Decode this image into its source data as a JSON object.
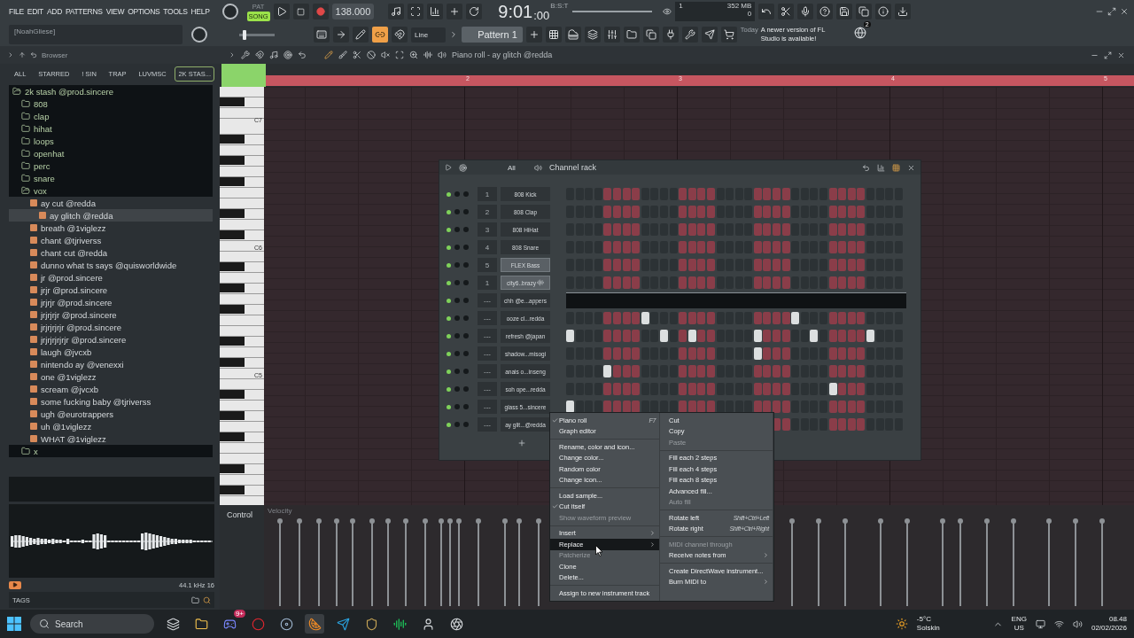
{
  "menu_bar": [
    "FILE",
    "EDIT",
    "ADD",
    "PATTERNS",
    "VIEW",
    "OPTIONS",
    "TOOLS",
    "HELP"
  ],
  "hint_panel": "[NoahGliese]",
  "master_pitch": {
    "level": 0.1
  },
  "transport": {
    "modes": [
      {
        "label": "PAT",
        "selected": false
      },
      {
        "label": "SONG",
        "selected": true
      }
    ],
    "tempo": "138.000"
  },
  "clock": {
    "time": "9:01",
    "ticks": ":00",
    "format": "B:S:T"
  },
  "monitor": {
    "voices": "1",
    "memory": "352 MB",
    "polyphony": "0"
  },
  "snap": "Line",
  "pattern": "Pattern 1",
  "news": {
    "date": "Today",
    "message": "A newer version of FL Studio is available!",
    "badge": "2"
  },
  "browser": {
    "title": "Browser",
    "tabs": [
      {
        "label": "ALL",
        "selected": false
      },
      {
        "label": "STARRED",
        "selected": false
      },
      {
        "label": "! SIN",
        "selected": false
      },
      {
        "label": "TRAP",
        "selected": false
      },
      {
        "label": "LUVMSC",
        "selected": false
      },
      {
        "label": "2K STAS...",
        "selected": true
      }
    ],
    "tree": [
      {
        "label": "2k stash @prod.sincere",
        "kind": "folder",
        "expanded": true,
        "selected": false,
        "children": [
          {
            "label": "808",
            "kind": "folder",
            "expanded": false,
            "selected": false
          },
          {
            "label": "clap",
            "kind": "folder",
            "expanded": false,
            "selected": false
          },
          {
            "label": "hihat",
            "kind": "folder",
            "expanded": false,
            "selected": false
          },
          {
            "label": "loops",
            "kind": "folder",
            "expanded": false,
            "selected": false
          },
          {
            "label": "openhat",
            "kind": "folder",
            "expanded": false,
            "selected": false
          },
          {
            "label": "perc",
            "kind": "folder",
            "expanded": false,
            "selected": false
          },
          {
            "label": "snare",
            "kind": "folder",
            "expanded": false,
            "selected": false
          },
          {
            "label": "vox",
            "kind": "folder",
            "expanded": true,
            "selected": false,
            "children": [
              {
                "label": "ay cut @redda",
                "kind": "file",
                "selected": false,
                "children": [
                  {
                    "label": "ay glitch @redda",
                    "kind": "file",
                    "selected": true
                  }
                ]
              },
              {
                "label": "breath @1viglezz",
                "kind": "file",
                "selected": false
              },
              {
                "label": "chant @tjriverss",
                "kind": "file",
                "selected": false
              },
              {
                "label": "chant cut @redda",
                "kind": "file",
                "selected": false
              },
              {
                "label": "dunno what ts says @quisworldwide",
                "kind": "file",
                "selected": false
              },
              {
                "label": "jr @prod.sincere",
                "kind": "file",
                "selected": false
              },
              {
                "label": "jrjr @prod.sincere",
                "kind": "file",
                "selected": false
              },
              {
                "label": "jrjrjr @prod.sincere",
                "kind": "file",
                "selected": false
              },
              {
                "label": "jrjrjrjr @prod.sincere",
                "kind": "file",
                "selected": false
              },
              {
                "label": "jrjrjrjrjr @prod.sincere",
                "kind": "file",
                "selected": false
              },
              {
                "label": "jrjrjrjrjrjr @prod.sincere",
                "kind": "file",
                "selected": false
              },
              {
                "label": "laugh @jvcxb",
                "kind": "file",
                "selected": false
              },
              {
                "label": "nintendo ay @venexxi",
                "kind": "file",
                "selected": false
              },
              {
                "label": "one @1viglezz",
                "kind": "file",
                "selected": false
              },
              {
                "label": "scream @jvcxb",
                "kind": "file",
                "selected": false
              },
              {
                "label": "some fucking baby @tjriverss",
                "kind": "file",
                "selected": false
              },
              {
                "label": "ugh @eurotrappers",
                "kind": "file",
                "selected": false
              },
              {
                "label": "uh @1viglezz",
                "kind": "file",
                "selected": false
              },
              {
                "label": "WHAT @1viglezz",
                "kind": "file",
                "selected": false
              }
            ]
          },
          {
            "label": "x",
            "kind": "folder",
            "expanded": false,
            "selected": false
          }
        ]
      }
    ],
    "sample_info": "44.1 kHz 16",
    "tags_label": "TAGS"
  },
  "piano_roll": {
    "title": "Piano roll - ay glitch @redda",
    "bars": [
      "2",
      "3",
      "4",
      "5"
    ],
    "octaves": [
      "C7",
      "C6",
      "C5"
    ],
    "control_label": "Control",
    "lane": "Velocity"
  },
  "channel_rack": {
    "filter": "All",
    "title": "Channel rack",
    "channels": [
      {
        "number": "1",
        "name": "808 Kick",
        "kind": "steps",
        "selected": false,
        "steps": [
          false,
          false,
          false,
          false,
          false,
          false,
          false,
          false,
          false,
          false,
          false,
          false,
          false,
          false,
          false,
          false,
          false,
          false,
          false,
          false,
          false,
          false,
          false,
          false,
          false,
          false,
          false,
          false,
          false,
          false,
          false,
          false,
          false,
          false,
          false,
          false
        ]
      },
      {
        "number": "2",
        "name": "808 Clap",
        "kind": "steps",
        "selected": false,
        "steps": [
          false,
          false,
          false,
          false,
          false,
          false,
          false,
          false,
          false,
          false,
          false,
          false,
          false,
          false,
          false,
          false,
          false,
          false,
          false,
          false,
          false,
          false,
          false,
          false,
          false,
          false,
          false,
          false,
          false,
          false,
          false,
          false,
          false,
          false,
          false,
          false
        ]
      },
      {
        "number": "3",
        "name": "808 HiHat",
        "kind": "steps",
        "selected": false,
        "steps": [
          false,
          false,
          false,
          false,
          false,
          false,
          false,
          false,
          false,
          false,
          false,
          false,
          false,
          false,
          false,
          false,
          false,
          false,
          false,
          false,
          false,
          false,
          false,
          false,
          false,
          false,
          false,
          false,
          false,
          false,
          false,
          false,
          false,
          false,
          false,
          false
        ]
      },
      {
        "number": "4",
        "name": "808 Snare",
        "kind": "steps",
        "selected": false,
        "steps": [
          false,
          false,
          false,
          false,
          false,
          false,
          false,
          false,
          false,
          false,
          false,
          false,
          false,
          false,
          false,
          false,
          false,
          false,
          false,
          false,
          false,
          false,
          false,
          false,
          false,
          false,
          false,
          false,
          false,
          false,
          false,
          false,
          false,
          false,
          false,
          false
        ]
      },
      {
        "number": "5",
        "name": "FLEX Bass",
        "kind": "steps",
        "selected": true,
        "steps": [
          false,
          false,
          false,
          false,
          false,
          false,
          false,
          false,
          false,
          false,
          false,
          false,
          false,
          false,
          false,
          false,
          false,
          false,
          false,
          false,
          false,
          false,
          false,
          false,
          false,
          false,
          false,
          false,
          false,
          false,
          false,
          false,
          false,
          false,
          false,
          false
        ]
      },
      {
        "number": "1",
        "name": "city6..brazy",
        "kind": "audio",
        "selected": true,
        "steps": [
          false,
          false,
          false,
          false,
          false,
          false,
          false,
          false,
          false,
          false,
          false,
          false,
          false,
          false,
          false,
          false,
          false,
          false,
          false,
          false,
          false,
          false,
          false,
          false,
          false,
          false,
          false,
          false,
          false,
          false,
          false,
          false,
          false,
          false,
          false,
          false
        ]
      },
      {
        "number": "---",
        "name": "chh @e...appers",
        "kind": "pianoroll",
        "selected": false
      },
      {
        "number": "---",
        "name": "ooze cl...redda",
        "kind": "steps",
        "selected": false,
        "steps": [
          false,
          false,
          false,
          false,
          false,
          false,
          false,
          false,
          true,
          false,
          false,
          false,
          false,
          false,
          false,
          false,
          false,
          false,
          false,
          false,
          false,
          false,
          false,
          false,
          true,
          false,
          false,
          false,
          false,
          false,
          false,
          false,
          false,
          false,
          false,
          false
        ]
      },
      {
        "number": "---",
        "name": "refresh @japan",
        "kind": "steps",
        "selected": false,
        "steps": [
          true,
          false,
          false,
          false,
          false,
          false,
          false,
          false,
          false,
          false,
          true,
          false,
          false,
          true,
          false,
          false,
          false,
          false,
          false,
          false,
          true,
          false,
          false,
          false,
          false,
          false,
          true,
          false,
          false,
          false,
          false,
          false,
          true,
          false,
          false,
          false
        ]
      },
      {
        "number": "---",
        "name": "shadow...misogi",
        "kind": "steps",
        "selected": false,
        "steps": [
          false,
          false,
          false,
          false,
          false,
          false,
          false,
          false,
          false,
          false,
          false,
          false,
          false,
          false,
          false,
          false,
          false,
          false,
          false,
          false,
          true,
          false,
          false,
          false,
          false,
          false,
          false,
          false,
          false,
          false,
          false,
          false,
          false,
          false,
          false,
          false
        ]
      },
      {
        "number": "---",
        "name": "anais o...inseng",
        "kind": "steps",
        "selected": false,
        "steps": [
          false,
          false,
          false,
          false,
          true,
          false,
          false,
          false,
          false,
          false,
          false,
          false,
          false,
          false,
          false,
          false,
          false,
          false,
          false,
          false,
          false,
          false,
          false,
          false,
          false,
          false,
          false,
          false,
          false,
          false,
          false,
          false,
          false,
          false,
          false,
          false
        ]
      },
      {
        "number": "---",
        "name": "soh ope...redda",
        "kind": "steps",
        "selected": false,
        "steps": [
          false,
          false,
          false,
          false,
          false,
          false,
          false,
          false,
          false,
          false,
          false,
          false,
          false,
          false,
          false,
          false,
          false,
          false,
          false,
          false,
          false,
          false,
          false,
          false,
          false,
          false,
          false,
          false,
          true,
          false,
          false,
          false,
          false,
          false,
          false,
          false
        ]
      },
      {
        "number": "---",
        "name": "glass 5...sincere",
        "kind": "steps",
        "selected": false,
        "steps": [
          true,
          false,
          false,
          false,
          false,
          false,
          false,
          false,
          false,
          false,
          false,
          false,
          false,
          false,
          false,
          false,
          false,
          false,
          false,
          false,
          false,
          false,
          false,
          false,
          false,
          false,
          false,
          false,
          false,
          false,
          false,
          false,
          false,
          false,
          false,
          false
        ]
      },
      {
        "number": "---",
        "name": "ay glit...@redda",
        "kind": "steps",
        "selected": false,
        "steps": [
          false,
          false,
          false,
          false,
          false,
          false,
          false,
          false,
          false,
          false,
          false,
          false,
          false
        ]
      }
    ]
  },
  "context_menu": {
    "columns": [
      [
        {
          "kind": "item",
          "label": "Piano roll",
          "shortcut": "F7",
          "checked": true,
          "disabled": false,
          "highlighted": false,
          "submenu": false
        },
        {
          "kind": "item",
          "label": "Graph editor",
          "checked": false,
          "disabled": false,
          "highlighted": false,
          "submenu": false
        },
        {
          "kind": "separator"
        },
        {
          "kind": "item",
          "label": "Rename, color and icon...",
          "checked": false,
          "disabled": false,
          "highlighted": false,
          "submenu": false
        },
        {
          "kind": "item",
          "label": "Change color...",
          "checked": false,
          "disabled": false,
          "highlighted": false,
          "submenu": false
        },
        {
          "kind": "item",
          "label": "Random color",
          "checked": false,
          "disabled": false,
          "highlighted": false,
          "submenu": false
        },
        {
          "kind": "item",
          "label": "Change icon...",
          "checked": false,
          "disabled": false,
          "highlighted": false,
          "submenu": false
        },
        {
          "kind": "separator"
        },
        {
          "kind": "item",
          "label": "Load sample...",
          "checked": false,
          "disabled": false,
          "highlighted": false,
          "submenu": false
        },
        {
          "kind": "item",
          "label": "Cut itself",
          "checked": true,
          "disabled": false,
          "highlighted": false,
          "submenu": false
        },
        {
          "kind": "item",
          "label": "Show waveform preview",
          "checked": false,
          "disabled": true,
          "highlighted": false,
          "submenu": false
        },
        {
          "kind": "separator"
        },
        {
          "kind": "item",
          "label": "Insert",
          "checked": false,
          "disabled": false,
          "highlighted": false,
          "submenu": true
        },
        {
          "kind": "item",
          "label": "Replace",
          "checked": false,
          "disabled": false,
          "highlighted": true,
          "submenu": true
        },
        {
          "kind": "item",
          "label": "Patcherize",
          "checked": false,
          "disabled": true,
          "highlighted": false,
          "submenu": false
        },
        {
          "kind": "item",
          "label": "Clone",
          "checked": false,
          "disabled": false,
          "highlighted": false,
          "submenu": false
        },
        {
          "kind": "item",
          "label": "Delete...",
          "checked": false,
          "disabled": false,
          "highlighted": false,
          "submenu": false
        },
        {
          "kind": "separator"
        },
        {
          "kind": "item",
          "label": "Assign to new instrument track",
          "checked": false,
          "disabled": false,
          "highlighted": false,
          "submenu": false
        }
      ],
      [
        {
          "kind": "item",
          "label": "Cut",
          "checked": false,
          "disabled": false,
          "highlighted": false,
          "submenu": false
        },
        {
          "kind": "item",
          "label": "Copy",
          "checked": false,
          "disabled": false,
          "highlighted": false,
          "submenu": false
        },
        {
          "kind": "item",
          "label": "Paste",
          "checked": false,
          "disabled": true,
          "highlighted": false,
          "submenu": false
        },
        {
          "kind": "separator"
        },
        {
          "kind": "item",
          "label": "Fill each 2 steps",
          "checked": false,
          "disabled": false,
          "highlighted": false,
          "submenu": false
        },
        {
          "kind": "item",
          "label": "Fill each 4 steps",
          "checked": false,
          "disabled": false,
          "highlighted": false,
          "submenu": false
        },
        {
          "kind": "item",
          "label": "Fill each 8 steps",
          "checked": false,
          "disabled": false,
          "highlighted": false,
          "submenu": false
        },
        {
          "kind": "item",
          "label": "Advanced fill...",
          "checked": false,
          "disabled": false,
          "highlighted": false,
          "submenu": false
        },
        {
          "kind": "item",
          "label": "Auto fill",
          "checked": false,
          "disabled": true,
          "highlighted": false,
          "submenu": false
        },
        {
          "kind": "separator"
        },
        {
          "kind": "item",
          "label": "Rotate left",
          "shortcut": "Shift+Ctrl+Left",
          "checked": false,
          "disabled": false,
          "highlighted": false,
          "submenu": false
        },
        {
          "kind": "item",
          "label": "Rotate right",
          "shortcut": "Shift+Ctrl+Right",
          "checked": false,
          "disabled": false,
          "highlighted": false,
          "submenu": false
        },
        {
          "kind": "separator"
        },
        {
          "kind": "item",
          "label": "MIDI channel through",
          "checked": false,
          "disabled": true,
          "highlighted": false,
          "submenu": false
        },
        {
          "kind": "item",
          "label": "Receive notes from",
          "checked": false,
          "disabled": false,
          "highlighted": false,
          "submenu": true
        },
        {
          "kind": "separator"
        },
        {
          "kind": "item",
          "label": "Create DirectWave instrument...",
          "checked": false,
          "disabled": false,
          "highlighted": false,
          "submenu": false
        },
        {
          "kind": "item",
          "label": "Burn MIDI to",
          "checked": false,
          "disabled": false,
          "highlighted": false,
          "submenu": true
        }
      ]
    ]
  },
  "taskbar": {
    "search": "Search",
    "notification_badge": "9+",
    "temperature": "-5°C",
    "weather": "Solskin",
    "language": "ENG",
    "region": "US",
    "time": "08.48",
    "date": "02/02/2026"
  }
}
